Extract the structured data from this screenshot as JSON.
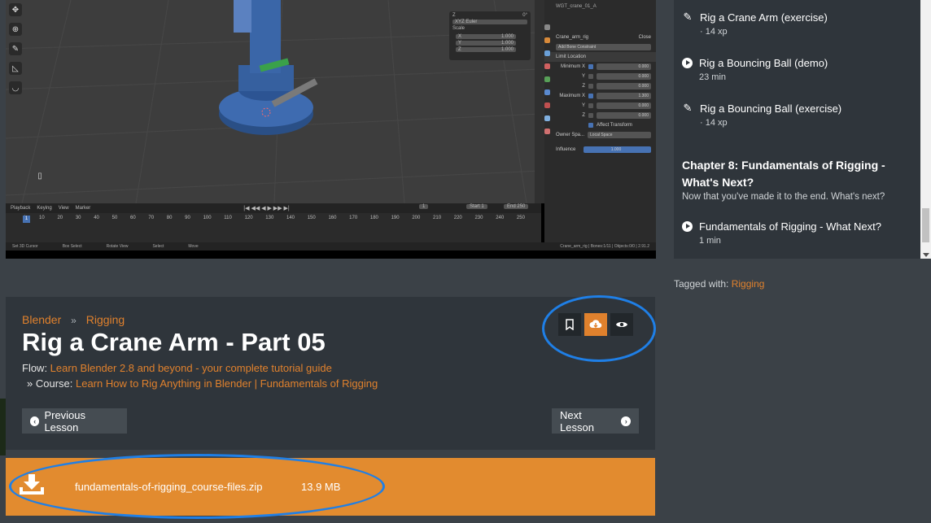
{
  "video": {
    "mode_label": "XYZ Euler",
    "scale_label": "Scale",
    "scale_rows": [
      {
        "axis": "X",
        "value": "1.000"
      },
      {
        "axis": "Y",
        "value": "1.000"
      },
      {
        "axis": "Z",
        "value": "1.000"
      }
    ],
    "rotation_z": "0°",
    "properties": {
      "object_name": "Crane_arm_rig",
      "close_label": "Close",
      "add_constraint": "Add Bone Constraint",
      "constraint_name": "Limit Location",
      "rows": [
        {
          "label": "Minimum X",
          "value": "0.000",
          "checked": true
        },
        {
          "label": "Y",
          "value": "0.000",
          "checked": false
        },
        {
          "label": "Z",
          "value": "0.000",
          "checked": false
        },
        {
          "label": "Maximum X",
          "value": "1.300",
          "checked": true
        },
        {
          "label": "Y",
          "value": "0.000",
          "checked": false
        },
        {
          "label": "Z",
          "value": "0.000",
          "checked": false
        }
      ],
      "affect_transform": "Affect Transform",
      "owner_space_label": "Owner Spa...",
      "owner_space_value": "Local Space",
      "influence_label": "Influence",
      "influence_value": "1.000"
    },
    "timeline": {
      "menu": [
        "Playback",
        "Keying",
        "View",
        "Marker"
      ],
      "current_frame": "1",
      "start_label": "Start",
      "start_value": "1",
      "end_label": "End",
      "end_value": "250",
      "ticks": [
        "1",
        "10",
        "20",
        "30",
        "40",
        "50",
        "60",
        "70",
        "80",
        "90",
        "100",
        "110",
        "120",
        "130",
        "140",
        "150",
        "160",
        "170",
        "180",
        "190",
        "200",
        "210",
        "220",
        "230",
        "240",
        "250"
      ]
    },
    "statusbar": [
      "Set 3D Cursor",
      "Box Select",
      "Rotate View",
      "Select",
      "Move"
    ],
    "statusbar_right": "Crane_arm_rig | Bones:1/11 | Objects:0/0 | 2.91.2"
  },
  "sidebar": {
    "items": [
      {
        "icon": "pencil-icon",
        "title": "Rig a Crane Arm (exercise)",
        "meta": "· 14 xp"
      },
      {
        "icon": "play-icon",
        "title": "Rig a Bouncing Ball (demo)",
        "meta": "23 min"
      },
      {
        "icon": "pencil-icon",
        "title": "Rig a Bouncing Ball (exercise)",
        "meta": "· 14 xp"
      }
    ],
    "chapter_title": "Chapter 8:  Fundamentals of Rigging - What's Next?",
    "chapter_desc": "Now that you've made it to the end.  What's next?",
    "last_item": {
      "icon": "play-icon",
      "title": "Fundamentals of Rigging - What Next?",
      "meta": "1 min"
    }
  },
  "tagged": {
    "prefix": "Tagged with: ",
    "tag": "Rigging"
  },
  "lesson": {
    "crumb_1": "Blender",
    "crumb_sep": "»",
    "crumb_2": "Rigging",
    "title": "Rig a Crane Arm - Part 05",
    "flow_prefix": "Flow: ",
    "flow_link": "Learn Blender 2.8 and beyond - your complete tutorial guide",
    "course_prefix": "» Course: ",
    "course_link": "Learn How to Rig Anything in Blender | Fundamentals of Rigging",
    "prev_label": "Previous Lesson",
    "next_label": "Next Lesson"
  },
  "download": {
    "filename": "fundamentals-of-rigging_course-files.zip",
    "size": "13.9 MB"
  },
  "colors": {
    "accent": "#e0812d",
    "highlight": "#1f7fe6",
    "panel": "#2f353b"
  }
}
